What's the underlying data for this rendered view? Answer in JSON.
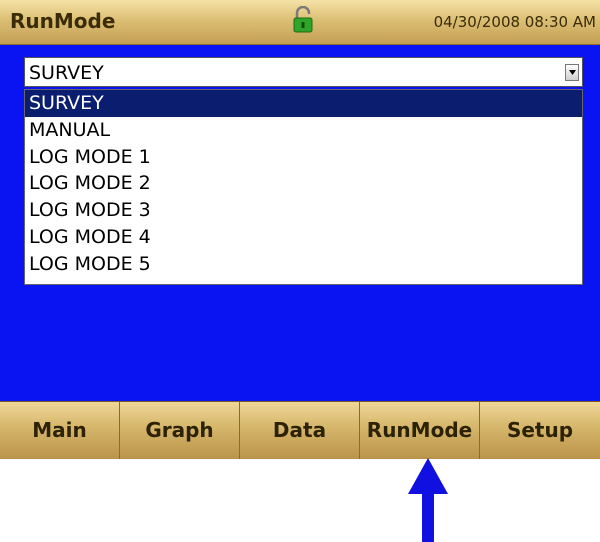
{
  "header": {
    "title": "RunMode",
    "lock_icon": "unlocked-padlock-icon",
    "datetime": "04/30/2008 08:30 AM"
  },
  "runmode_select": {
    "selected": "SURVEY",
    "options": [
      "SURVEY",
      "MANUAL",
      "LOG MODE 1",
      "LOG MODE 2",
      "LOG MODE 3",
      "LOG MODE 4",
      "LOG MODE 5"
    ],
    "highlighted_index": 0
  },
  "tabs": [
    {
      "label": "Main"
    },
    {
      "label": "Graph"
    },
    {
      "label": "Data"
    },
    {
      "label": "RunMode"
    },
    {
      "label": "Setup"
    }
  ],
  "colors": {
    "screen_background": "#0a13f2",
    "highlight": "#0a1d6e",
    "tab_gold": "#d8b96e",
    "annotation_arrow": "#1010e0"
  }
}
